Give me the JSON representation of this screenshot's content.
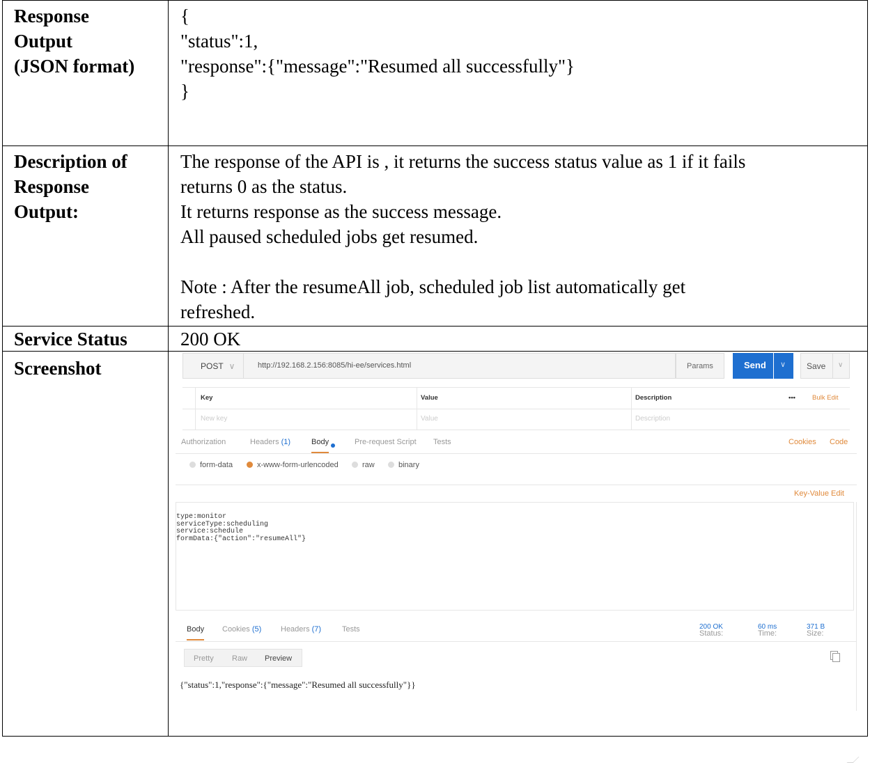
{
  "rows": [
    {
      "label": [
        "Response",
        "Output",
        "(JSON format)"
      ],
      "value": [
        "{",
        "\"status\":1,",
        "\"response\":{\"message\":\"Resumed all successfully\"}",
        "}"
      ]
    },
    {
      "label": [
        "Description of",
        "Response",
        "Output:"
      ],
      "value": [
        "The response of the API is , it returns the success status value as 1 if it fails",
        "returns 0 as the status.",
        "It returns response as the success message.",
        "All paused scheduled jobs get resumed.",
        "",
        "Note : After the resumeAll job, scheduled job list automatically get",
        "refreshed."
      ]
    },
    {
      "label": [
        "Service Status"
      ],
      "value": [
        "200 OK"
      ]
    },
    {
      "label": [
        "Screenshot"
      ]
    }
  ],
  "postman": {
    "method": "POST",
    "url": "http://192.168.2.156:8085/hi-ee/services.html",
    "params": "Params",
    "send": "Send",
    "save": "Save",
    "kv_headers": {
      "key": "Key",
      "value": "Value",
      "description": "Description",
      "more": "•••",
      "bulk": "Bulk Edit"
    },
    "kv_placeholder": {
      "key": "New key",
      "value": "Value",
      "description": "Description"
    },
    "tabs": {
      "authorization": "Authorization",
      "headers": "Headers",
      "headers_count": "(1)",
      "body": "Body",
      "prerequest": "Pre-request Script",
      "tests": "Tests",
      "cookies": "Cookies",
      "code": "Code"
    },
    "body_modes": [
      "form-data",
      "x-www-form-urlencoded",
      "raw",
      "binary"
    ],
    "selected_mode": "x-www-form-urlencoded",
    "key_value_edit": "Key-Value Edit",
    "body_text": "type:monitor\nserviceType:scheduling\nservice:schedule\nformData:{\"action\":\"resumeAll\"}",
    "response_tabs": {
      "body": "Body",
      "cookies": "Cookies",
      "cookies_count": "(5)",
      "headers": "Headers",
      "headers_count": "(7)",
      "tests": "Tests"
    },
    "status_label": "Status:",
    "status_value": "200 OK",
    "time_label": "Time:",
    "time_value": "60 ms",
    "size_label": "Size:",
    "size_value": "371 B",
    "view_buttons": {
      "pretty": "Pretty",
      "raw": "Raw",
      "preview": "Preview"
    },
    "response_text": "{\"status\":1,\"response\":{\"message\":\"Resumed all successfully\"}}"
  }
}
